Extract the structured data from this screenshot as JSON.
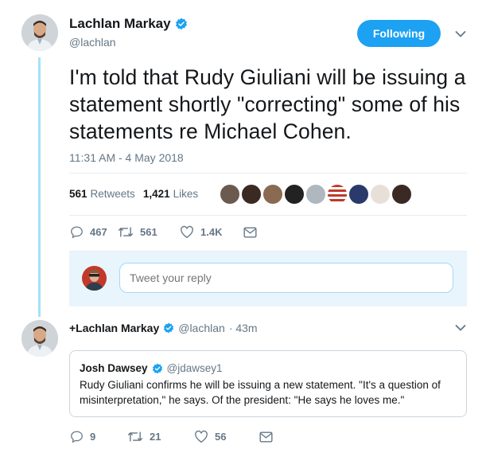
{
  "tweet": {
    "author_name": "Lachlan Markay",
    "author_handle": "@lachlan",
    "follow_label": "Following",
    "text": "I'm told that Rudy Giuliani will be issuing a statement shortly \"correcting\" some of his statements re Michael Cohen.",
    "timestamp": "11:31 AM - 4 May 2018",
    "retweets_count": "561",
    "retweets_label": "Retweets",
    "likes_count": "1,421",
    "likes_label": "Likes",
    "actions": {
      "replies": "467",
      "retweets": "561",
      "likes": "1.4K"
    }
  },
  "reply": {
    "placeholder": "Tweet your reply"
  },
  "followup": {
    "author_name": "+Lachlan Markay",
    "author_handle": "@lachlan",
    "time": "· 43m",
    "quote": {
      "author_name": "Josh Dawsey",
      "author_handle": "@jdawsey1",
      "text": "Rudy Giuliani confirms he will be issuing a new statement. \"It's a question of misinterpretation,\" he says. Of the president: \"He says he loves me.\""
    },
    "actions": {
      "replies": "9",
      "retweets": "21",
      "likes": "56"
    }
  },
  "colors": {
    "accent": "#1da1f2",
    "thread_line": "#a5e3f7",
    "muted": "#657786"
  },
  "likers": [
    {
      "color": "#6b5a4e"
    },
    {
      "color": "#3a2a22"
    },
    {
      "color": "#8a6a50"
    },
    {
      "color": "#222222"
    },
    {
      "color": "#b0b8bf"
    },
    {
      "color": "#c0392b"
    },
    {
      "color": "#2b3a6b"
    },
    {
      "color": "#e8e0d8"
    },
    {
      "color": "#3b2a24"
    }
  ]
}
